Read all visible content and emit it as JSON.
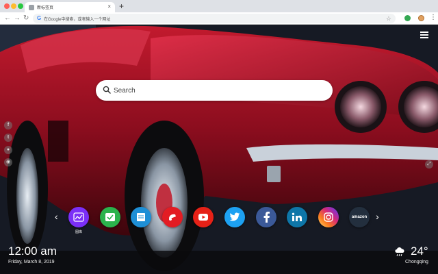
{
  "browser": {
    "tab_title": "新标签页",
    "tab_close": "×",
    "new_tab": "+",
    "address_placeholder": "在Google中搜索，或者输入一个网址",
    "g_letter": "G",
    "star": "☆",
    "menu": "⋮",
    "back": "←",
    "forward": "→",
    "reload": "↻"
  },
  "search": {
    "placeholder": "Search"
  },
  "social_left": [
    {
      "icon": "facebook-icon",
      "glyph": "f"
    },
    {
      "icon": "twitter-icon",
      "glyph": "t"
    },
    {
      "icon": "user-icon",
      "glyph": "●"
    },
    {
      "icon": "wechat-icon",
      "glyph": "◉"
    }
  ],
  "right_button": {
    "icon": "expand-icon",
    "glyph": "⤢"
  },
  "apps": {
    "prev": "‹",
    "next": "›",
    "items": [
      {
        "name": "gallery",
        "label": "图库",
        "color": "#7b2ff7"
      },
      {
        "name": "checklist",
        "color": "#2bb24c"
      },
      {
        "name": "notes",
        "color": "#1e8fd6"
      },
      {
        "name": "game",
        "color": "#e31c23"
      },
      {
        "name": "youtube",
        "color": "#e62117"
      },
      {
        "name": "twitter",
        "color": "#1da1f2"
      },
      {
        "name": "facebook",
        "color": "#3b5998"
      },
      {
        "name": "linkedin",
        "color": "#0e76a8"
      },
      {
        "name": "instagram",
        "color": "#c13584"
      },
      {
        "name": "amazon",
        "text": "amazon",
        "color": "#232f3e"
      }
    ]
  },
  "clock": {
    "time": "12:00 am",
    "date": "Friday, March 8, 2019"
  },
  "weather": {
    "temp": "24°",
    "city": "Chongqing"
  }
}
